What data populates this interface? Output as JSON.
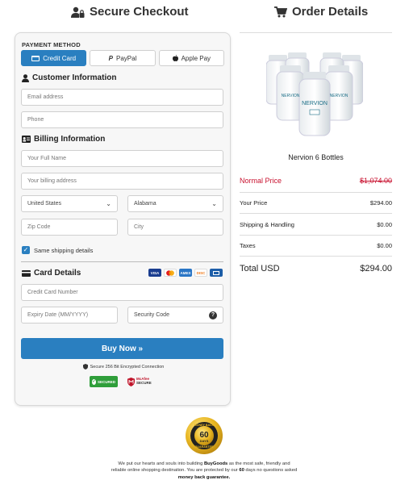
{
  "header": {
    "checkout_title": "Secure Checkout",
    "order_title": "Order Details"
  },
  "payment": {
    "section_label": "PAYMENT METHOD",
    "tabs": [
      {
        "label": "Credit Card",
        "active": true
      },
      {
        "label": "PayPal",
        "active": false
      },
      {
        "label": "Apple Pay",
        "active": false
      }
    ]
  },
  "customer": {
    "title": "Customer Information",
    "email_placeholder": "Email address",
    "phone_placeholder": "Phone"
  },
  "billing": {
    "title": "Billing Information",
    "name_placeholder": "Your Full Name",
    "address_placeholder": "Your billing address",
    "country_value": "United States",
    "state_value": "Alabama",
    "zip_placeholder": "Zip Code",
    "city_placeholder": "City",
    "same_shipping_label": "Same shipping details",
    "same_shipping_checked": true
  },
  "card": {
    "title": "Card Details",
    "number_placeholder": "Credit Card Number",
    "expiry_placeholder": "Expiry Date (MM/YYYY)",
    "cvv_placeholder": "Security Code",
    "brand_icons": [
      "visa-icon",
      "mastercard-icon",
      "amex-icon",
      "discover-icon",
      "generic-card-icon"
    ],
    "brand_labels": {
      "visa": "VISA",
      "amex": "AMEX",
      "discover": "DISC"
    }
  },
  "buy_button_label": "Buy Now »",
  "secure_text": "Secure 256 Bit Encrypted Connection",
  "trust_badges": {
    "secured_label": "SECURED",
    "mcafee_label": "McAfee",
    "mcafee_sub": "SECURE"
  },
  "order": {
    "product_image_text": "NERVION",
    "product_name": "Nervion 6 Bottles",
    "normal_price_label": "Normal Price",
    "normal_price_value": "$1,074.00",
    "rows": [
      {
        "label": "Your Price",
        "value": "$294.00"
      },
      {
        "label": "Shipping & Handling",
        "value": "$0.00"
      },
      {
        "label": "Taxes",
        "value": "$0.00"
      }
    ],
    "total_label": "Total USD",
    "total_value": "$294.00"
  },
  "guarantee": {
    "badge_number": "60",
    "badge_days": "DAYS",
    "badge_top": "MONEY BACK",
    "badge_bottom": "GUARANTEE"
  },
  "footer": {
    "p1": "We put our hearts and souls into building ",
    "brand": "BuyGoods",
    "p2": " as the most safe, friendly and reliable online shopping destination. You are protected by our ",
    "days": "60",
    "p3": " days no questions asked ",
    "guarantee": "money back guarantee."
  },
  "colors": {
    "accent": "#2a7fc0",
    "strike_red": "#c8102e"
  }
}
